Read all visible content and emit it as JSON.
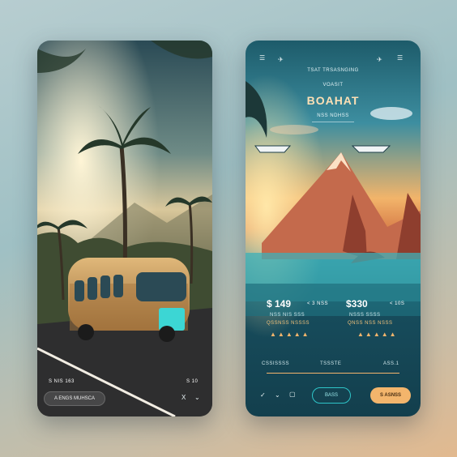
{
  "left_card": {
    "info_text": "S NIS 163",
    "corner_text": "S 10",
    "button_label": "A ENGS MUHSCA",
    "close_symbol": "X"
  },
  "right_card": {
    "subtitle": "TSAT TRSASNGING",
    "small_label": "VOASIT",
    "title": "BOAHAT",
    "tagline": "NSS NDHSS",
    "price_left": "$ 149",
    "price_right": "$330",
    "price_left_unit": "< 3 NSS",
    "price_right_unit": "< 10S",
    "detail_left": "NSS NIS SSS",
    "detail_right": "NSSS SSSS",
    "meta_left": "QSSNSS NSSSS",
    "meta_right": "QNSS NSS NSSS",
    "route_left": "CSSISSSS",
    "route_mid": "TSSSTE",
    "route_right": "ASS.1",
    "button_outline_label": "BASS",
    "button_primary_label": "S ASNSS",
    "colors": {
      "accent": "#f3b56c",
      "teal": "#2ec5c8"
    }
  }
}
